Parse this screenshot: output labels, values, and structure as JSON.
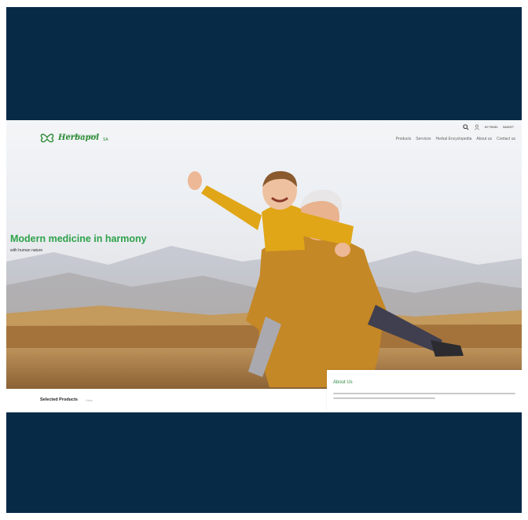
{
  "header": {
    "logo_text": "Herbapol",
    "logo_sup": "HERBAPOL-LUBLIN",
    "logo_sub": "SA",
    "search_icon": "search-icon",
    "user_icon": "user-icon",
    "account_label": "MY PANEL",
    "cart_label": "BASKET",
    "nav": [
      "Products",
      "Services",
      "Herbal Encyclopedia",
      "About us",
      "Contact us"
    ]
  },
  "hero": {
    "title": "Modern medicine in harmony",
    "subtitle": "with human nature"
  },
  "sections": {
    "selected_products": "Selected Products",
    "view_all": "View",
    "about_title": "About Us"
  },
  "colors": {
    "frame": "#072a47",
    "brand_green": "#2ea24a"
  }
}
